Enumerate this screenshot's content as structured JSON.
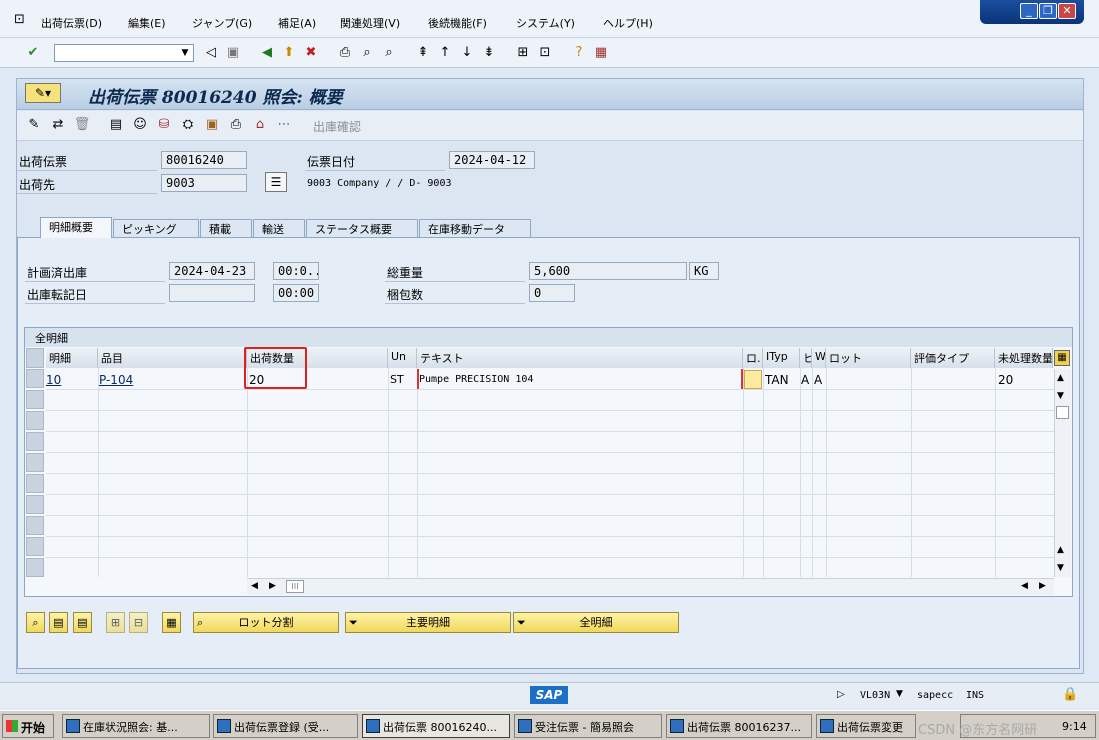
{
  "menu": {
    "items": [
      "出荷伝票(D)",
      "編集(E)",
      "ジャンプ(G)",
      "補足(A)",
      "関連処理(V)",
      "後続機能(F)",
      "システム(Y)",
      "ヘルプ(H)"
    ]
  },
  "header": {
    "title": "出荷伝票 80016240 照会: 概要",
    "app_toolbar_text": "出庫確認"
  },
  "form": {
    "delivery_label": "出荷伝票",
    "delivery_value": "80016240",
    "shipto_label": "出荷先",
    "shipto_value": "9003",
    "date_label": "伝票日付",
    "date_value": "2024-04-12",
    "shipto_desc": "9003 Company / / D- 9003"
  },
  "tabs": [
    "明細概要",
    "ピッキング",
    "積載",
    "輸送",
    "ステータス概要",
    "在庫移動データ"
  ],
  "overview": {
    "plan_gi_label": "計画済出庫",
    "plan_gi_date": "2024-04-23",
    "plan_gi_time": "00:0...",
    "act_gi_label": "出庫転記日",
    "act_gi_date": "",
    "act_gi_time": "00:00",
    "gross_weight_label": "総重量",
    "gross_weight_value": "5,600",
    "weight_unit": "KG",
    "packages_label": "梱包数",
    "packages_value": "0"
  },
  "table": {
    "title": "全明細",
    "columns": [
      "明細",
      "品目",
      "出荷数量",
      "Un",
      "テキスト",
      "ロ.",
      "ITyp",
      "ヒ",
      "W.",
      "ロット",
      "評価タイプ",
      "未処理数量"
    ],
    "row": {
      "item": "10",
      "material": "P-104",
      "qty": "20",
      "unit": "ST",
      "text": "Pumpe PRECISION 104",
      "itype": "TAN",
      "pick": "A",
      "wm": "A",
      "open_qty": "20"
    }
  },
  "buttons": {
    "batch_split": "ロット分割",
    "main_items": "主要明細",
    "all_items": "全明細"
  },
  "status": {
    "tcode": "VL03N",
    "system": "sapecc",
    "mode": "INS",
    "sap_logo": "SAP"
  },
  "taskbar": {
    "start": "开始",
    "tasks": [
      "在庫状況照会: 基...",
      "出荷伝票登録 (受...",
      "出荷伝票 80016240...",
      "受注伝票 - 簡易照会",
      "出荷伝票 80016237...",
      "出荷伝票変更"
    ],
    "watermark": "CSDN @东方名网研",
    "clock": "9:14"
  },
  "colors": {
    "highlight_box": "#e02020",
    "yellow_button": "#f5e27a",
    "title_text": "#0b2a4e"
  }
}
